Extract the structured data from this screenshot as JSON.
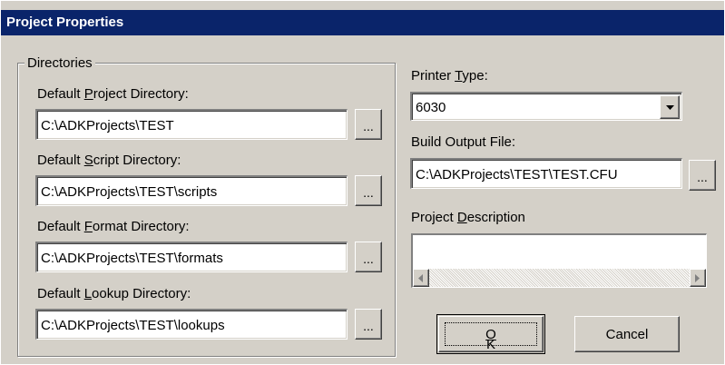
{
  "title": "Project Properties",
  "directories": {
    "group_label": "Directories",
    "project": {
      "label_pre": "Default ",
      "label_key": "P",
      "label_post": "roject Directory:",
      "value": "C:\\ADKProjects\\TEST"
    },
    "script": {
      "label_pre": "Default ",
      "label_key": "S",
      "label_post": "cript Directory:",
      "value": "C:\\ADKProjects\\TEST\\scripts"
    },
    "format": {
      "label_pre": "Default ",
      "label_key": "F",
      "label_post": "ormat Directory:",
      "value": "C:\\ADKProjects\\TEST\\formats"
    },
    "lookup": {
      "label_pre": "Default ",
      "label_key": "L",
      "label_post": "ookup Directory:",
      "value": "C:\\ADKProjects\\TEST\\lookups"
    },
    "browse_label": "..."
  },
  "printer": {
    "label_pre": "Printer ",
    "label_key": "T",
    "label_post": "ype:",
    "value": "6030"
  },
  "build_output": {
    "label": "Build Output File:",
    "value": "C:\\ADKProjects\\TEST\\TEST.CFU",
    "browse_label": "..."
  },
  "description": {
    "label_pre": "Project ",
    "label_key": "D",
    "label_post": "escription",
    "value": ""
  },
  "buttons": {
    "ok_key": "O",
    "ok_post": "K",
    "cancel": "Cancel"
  },
  "colors": {
    "titlebar": "#0a246a",
    "face": "#d4d0c8"
  }
}
